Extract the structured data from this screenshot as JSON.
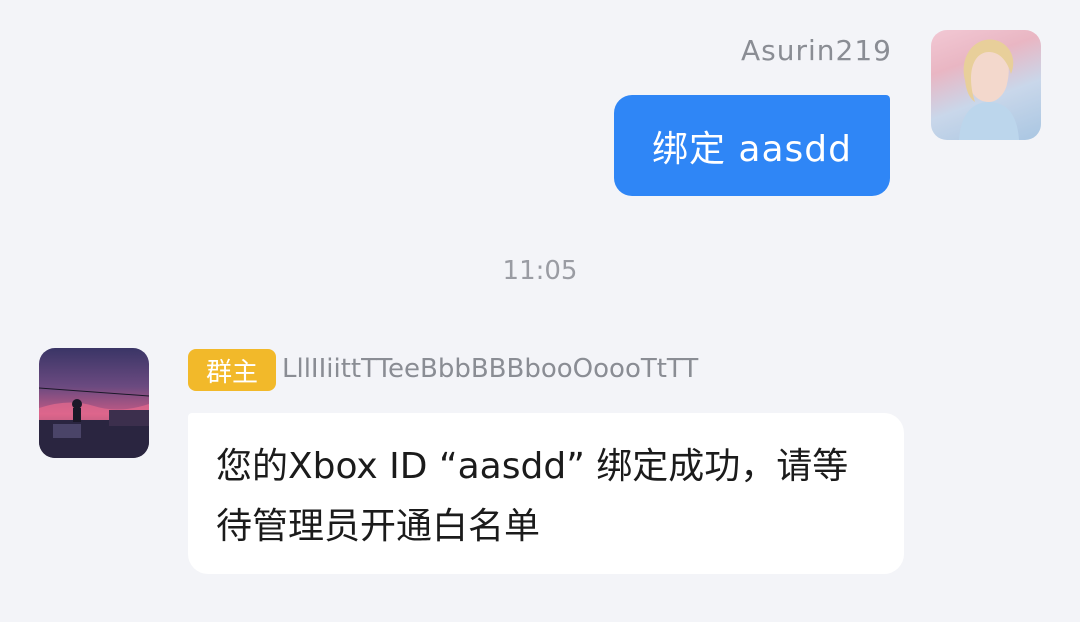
{
  "outgoing": {
    "sender_name": "Asurin219",
    "message": "绑定 aasdd"
  },
  "timestamp": "11:05",
  "incoming": {
    "role_badge": "群主",
    "sender_name": "LllIIiittTTeeBbbBBBbooOoooTtTT",
    "message": "您的Xbox ID “aasdd” 绑定成功，请等待管理员开通白名单"
  },
  "colors": {
    "background": "#f3f4f8",
    "outgoing_bubble": "#2f86f6",
    "incoming_bubble": "#ffffff",
    "role_badge": "#f2b92a"
  }
}
